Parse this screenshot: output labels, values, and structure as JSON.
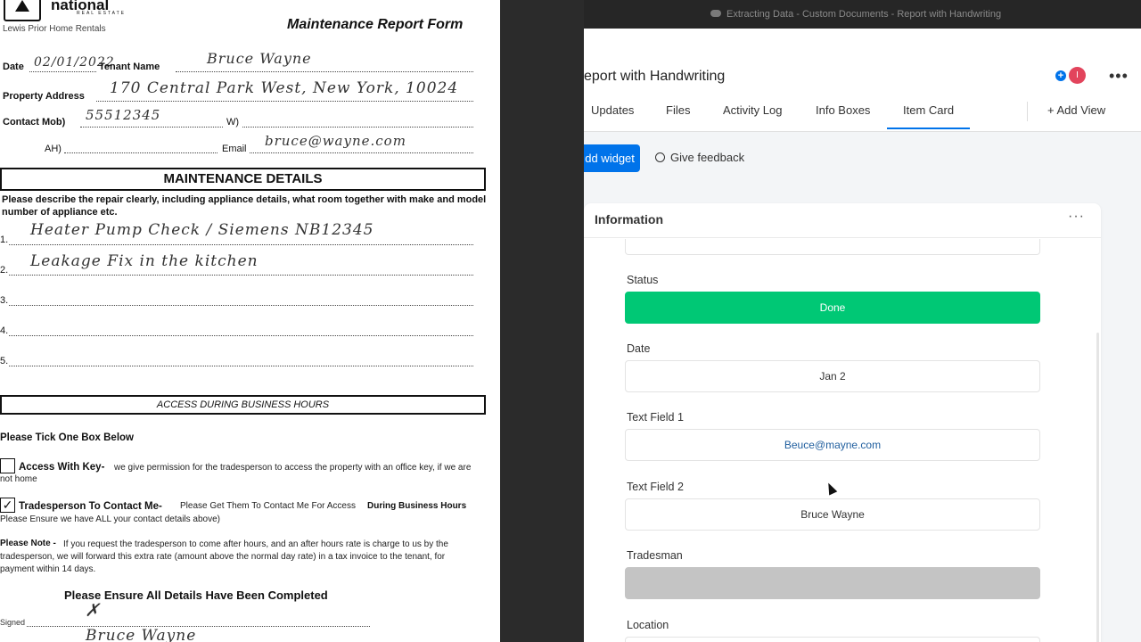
{
  "document": {
    "brand": "national",
    "brand_sub": "REAL ESTATE",
    "agency": "Lewis Prior Home Rentals",
    "form_title": "Maintenance Report Form",
    "date_label": "Date",
    "date_value": "02/01/2022",
    "tenant_label": "Tenant Name",
    "tenant_value": "Bruce Wayne",
    "address_label": "Property Address",
    "address_value": "170 Central Park West, New York, 10024",
    "contact_label": "Contact Mob)",
    "mob_value": "55512345",
    "w_label": "W)",
    "ah_label": "AH)",
    "email_label": "Email",
    "email_value": "bruce@wayne.com",
    "maintenance_heading": "MAINTENANCE DETAILS",
    "instructions": "Please describe the repair clearly, including appliance details, what room together with make and model number of appliance etc.",
    "items": [
      {
        "num": "1.",
        "text": "Heater Pump Check / Siemens NB12345"
      },
      {
        "num": "2.",
        "text": "Leakage Fix in the kitchen"
      },
      {
        "num": "3.",
        "text": ""
      },
      {
        "num": "4.",
        "text": ""
      },
      {
        "num": "5.",
        "text": ""
      }
    ],
    "access_heading": "ACCESS DURING BUSINESS HOURS",
    "tick_prompt": "Please Tick One Box Below",
    "access_key_title": "Access With Key-",
    "access_key_text": "we give permission for the tradesperson to access the property with an office key, if we are not home",
    "trades_title": "Tradesperson To Contact Me-",
    "trades_text": "Please Get Them To Contact Me For Access",
    "trades_bold": "During Business Hours",
    "trades_note": "Please Ensure we have ALL your contact details above)",
    "note_title": "Please Note -",
    "note_text": "If you request the tradesperson to come after hours, and an after hours rate is charge to us by the tradesperson, we will forward this extra rate (amount above the normal day rate) in a tax invoice to the tenant, for payment within 14 days.",
    "ensure_text": "Please Ensure All Details Have Been Completed",
    "signed_label": "Signed",
    "signature_name": "Bruce Wayne"
  },
  "window": {
    "title": "Extracting Data - Custom Documents - Report with Handwriting"
  },
  "app": {
    "board_title": "eport with Handwriting",
    "avatar_initial": "I",
    "tabs": [
      "Updates",
      "Files",
      "Activity Log",
      "Info Boxes",
      "Item Card"
    ],
    "active_tab": "Item Card",
    "add_view": "+  Add View",
    "add_widget": "dd widget",
    "give_feedback": "Give feedback",
    "panel_title": "Information",
    "fields": {
      "status_label": "Status",
      "status_value": "Done",
      "date_label": "Date",
      "date_value": "Jan 2",
      "text1_label": "Text Field 1",
      "text1_value": "Beuce@mayne.com",
      "text2_label": "Text Field 2",
      "text2_value": "Bruce Wayne",
      "tradesman_label": "Tradesman",
      "location_label": "Location"
    },
    "colors": {
      "accent": "#0073ea",
      "status_done": "#00c875",
      "avatar": "#e2445c",
      "tradesman_empty": "#c4c4c4"
    }
  }
}
